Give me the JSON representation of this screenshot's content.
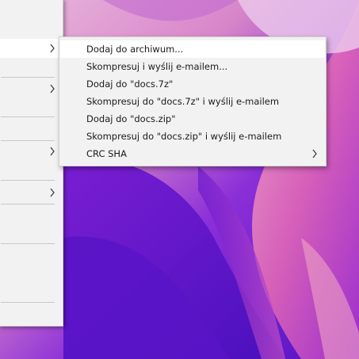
{
  "desktop": {
    "wallpaper_colors": [
      "#5b14c9",
      "#7a1fd6",
      "#b53bd2",
      "#e36ab8",
      "#f5b3c8",
      "#e9c7e9"
    ]
  },
  "parent_menu": {
    "highlighted_item": 0,
    "submenu_arrows": 4
  },
  "submenu": {
    "items": [
      {
        "label": "Dodaj do archiwum...",
        "has_submenu": false,
        "highlighted": true
      },
      {
        "label": "Skompresuj i wyślij e-mailem...",
        "has_submenu": false,
        "highlighted": false
      },
      {
        "label": "Dodaj do \"docs.7z\"",
        "has_submenu": false,
        "highlighted": false
      },
      {
        "label": "Skompresuj do \"docs.7z\" i wyślij e-mailem",
        "has_submenu": false,
        "highlighted": false
      },
      {
        "label": "Dodaj do \"docs.zip\"",
        "has_submenu": false,
        "highlighted": false
      },
      {
        "label": "Skompresuj do \"docs.zip\" i wyślij e-mailem",
        "has_submenu": false,
        "highlighted": false
      },
      {
        "label": "CRC SHA",
        "has_submenu": true,
        "highlighted": false
      }
    ]
  }
}
